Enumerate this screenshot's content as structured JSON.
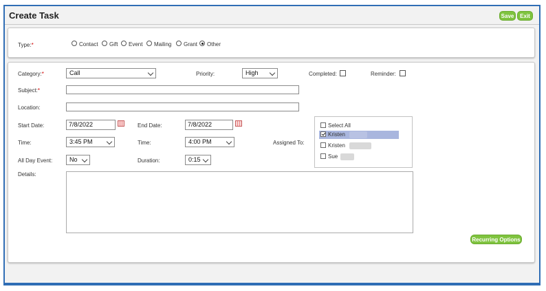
{
  "window": {
    "title": "Create Task",
    "save_label": "Save",
    "exit_label": "Exit"
  },
  "type_section": {
    "label": "Type:",
    "required_mark": "*",
    "options": [
      "Contact",
      "Gift",
      "Event",
      "Mailing",
      "Grant",
      "Other"
    ],
    "selected": "Other"
  },
  "form": {
    "category": {
      "label": "Category:",
      "required_mark": "*",
      "value": "Call"
    },
    "priority": {
      "label": "Priority:",
      "value": "High"
    },
    "completed": {
      "label": "Completed:",
      "checked": false
    },
    "reminder": {
      "label": "Reminder:",
      "checked": false
    },
    "subject": {
      "label": "Subject:",
      "required_mark": "*",
      "value": ""
    },
    "location": {
      "label": "Location:",
      "value": ""
    },
    "start_date": {
      "label": "Start Date:",
      "value": "7/8/2022"
    },
    "end_date": {
      "label": "End Date:",
      "value": "7/8/2022"
    },
    "start_time": {
      "label": "Time:",
      "value": "3:45 PM"
    },
    "end_time": {
      "label": "Time:",
      "value": "4:00 PM"
    },
    "assigned_to": {
      "label": "Assigned To:",
      "items": [
        {
          "label": "Select All",
          "checked": false,
          "selected": false
        },
        {
          "label": "Kristen",
          "checked": true,
          "selected": true
        },
        {
          "label": "Kristen",
          "checked": false,
          "selected": false
        },
        {
          "label": "Sue",
          "checked": false,
          "selected": false
        }
      ]
    },
    "all_day": {
      "label": "All Day Event:",
      "value": "No"
    },
    "duration": {
      "label": "Duration:",
      "value": "0:15"
    },
    "details": {
      "label": "Details:",
      "value": ""
    }
  },
  "recurring_label": "Recurring Options",
  "colors": {
    "accent_green": "#7fc33f",
    "frame_blue": "#2f6db5",
    "selected_row": "#a9b6de",
    "required_red": "#d00000"
  }
}
